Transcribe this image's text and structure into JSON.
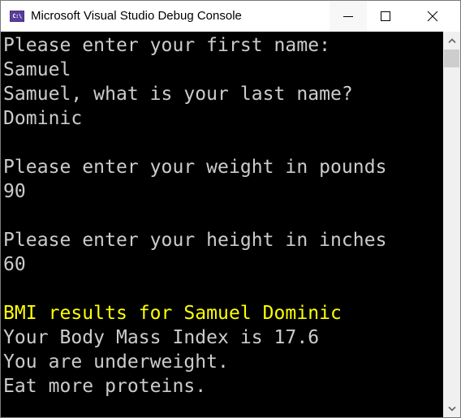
{
  "window": {
    "title": "Microsoft Visual Studio Debug Console",
    "app_icon_label": "C:\\",
    "controls": {
      "minimize": "minimize",
      "maximize": "maximize",
      "close": "close"
    }
  },
  "console": {
    "colors": {
      "background": "#000000",
      "default_text": "#cccccc",
      "highlight_text": "#ffff00"
    },
    "lines": [
      {
        "text": "Please enter your first name:",
        "color": "default"
      },
      {
        "text": "Samuel",
        "color": "default"
      },
      {
        "text": "Samuel, what is your last name?",
        "color": "default"
      },
      {
        "text": "Dominic",
        "color": "default"
      },
      {
        "text": "",
        "color": "default"
      },
      {
        "text": "Please enter your weight in pounds",
        "color": "default"
      },
      {
        "text": "90",
        "color": "default"
      },
      {
        "text": "",
        "color": "default"
      },
      {
        "text": "Please enter your height in inches",
        "color": "default"
      },
      {
        "text": "60",
        "color": "default"
      },
      {
        "text": "",
        "color": "default"
      },
      {
        "text": "BMI results for Samuel Dominic",
        "color": "highlight"
      },
      {
        "text": "Your Body Mass Index is 17.6",
        "color": "default"
      },
      {
        "text": "You are underweight.",
        "color": "default"
      },
      {
        "text": "Eat more proteins.",
        "color": "default"
      }
    ]
  }
}
